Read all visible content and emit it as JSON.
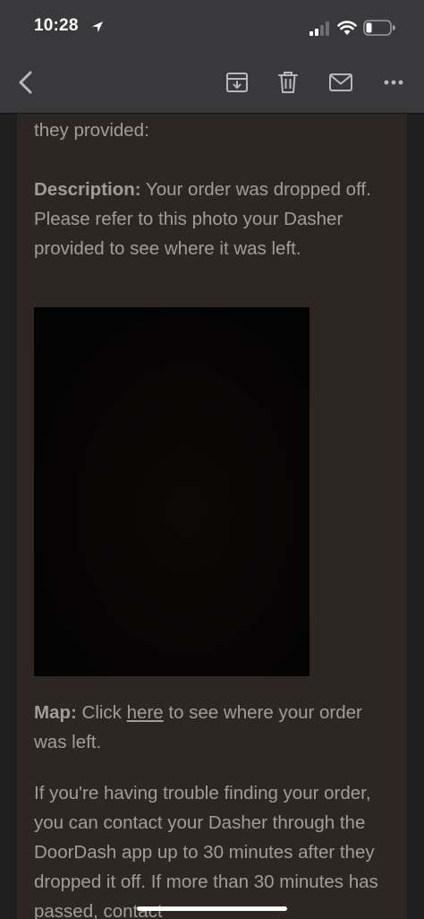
{
  "status_bar": {
    "time": "10:28",
    "icons": [
      "location-arrow-icon",
      "cellular-signal-icon",
      "wifi-icon",
      "battery-icon"
    ]
  },
  "toolbar": {
    "icons": [
      "chevron-left-icon",
      "archive-icon",
      "trash-icon",
      "mail-icon",
      "more-icon"
    ]
  },
  "email": {
    "partial_line": "they provided:",
    "description_label": "Description:",
    "description_text": " Your order was dropped off. Please refer to this photo your Dasher provided to see where it was left.",
    "map_label": "Map:",
    "map_text_before": " Click ",
    "map_link": "here",
    "map_text_after": " to see where your order was left.",
    "trouble_text": "If you're having trouble finding your order, you can contact your Dasher through the DoorDash app up to 30 minutes after they dropped it off. If more than 30 minutes has passed, contact"
  },
  "colors": {
    "card_background": "#2d2623",
    "body_text": "#a19d99",
    "toolbar_background": "#3a3a3c",
    "icon_color": "#b9b9bd"
  }
}
